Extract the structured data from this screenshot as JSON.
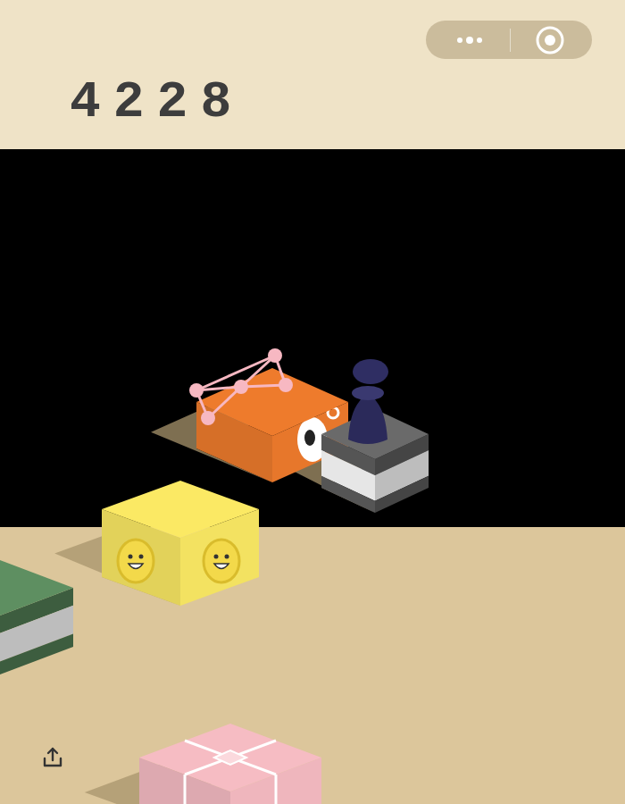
{
  "score": "4228",
  "platforms": [
    {
      "kind": "eye",
      "color": "#ee7b2c",
      "player_on": false
    },
    {
      "kind": "striped",
      "color": "#6a6a6a",
      "player_on": true
    },
    {
      "kind": "smiley",
      "color": "#fbe964",
      "player_on": false
    },
    {
      "kind": "striped",
      "color": "#5e8f61",
      "player_on": false
    },
    {
      "kind": "gift",
      "color": "#f6bcc3",
      "player_on": false
    }
  ]
}
